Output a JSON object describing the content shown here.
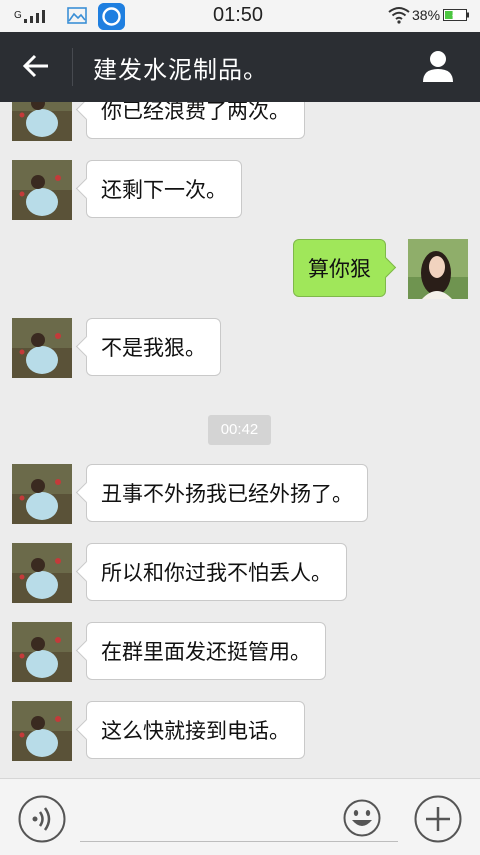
{
  "status_bar": {
    "signal_label": "G",
    "time": "01:50",
    "battery_percent": "38%",
    "battery_level": 0.38
  },
  "header": {
    "title": "建发水泥制品。",
    "accent_color": "#2b2e33"
  },
  "messages": [
    {
      "side": "in",
      "text": "你已经浪费了两次。"
    },
    {
      "side": "in",
      "text": "还剩下一次。"
    },
    {
      "side": "out",
      "text": "算你狠"
    },
    {
      "side": "in",
      "text": "不是我狠。"
    },
    {
      "side": "in",
      "text": "丑事不外扬我已经外扬了。"
    },
    {
      "side": "in",
      "text": "所以和你过我不怕丢人。"
    },
    {
      "side": "in",
      "text": "在群里面发还挺管用。"
    },
    {
      "side": "in",
      "text": "这么快就接到电话。"
    }
  ],
  "timestamp": "00:42",
  "colors": {
    "outgoing_bubble": "#a0e75a",
    "incoming_bubble": "#ffffff",
    "chat_background": "#ececec"
  },
  "icons": {
    "back": "back-arrow-icon",
    "profile": "profile-icon",
    "voice": "voice-icon",
    "emoji": "emoji-icon",
    "plus": "plus-icon"
  }
}
